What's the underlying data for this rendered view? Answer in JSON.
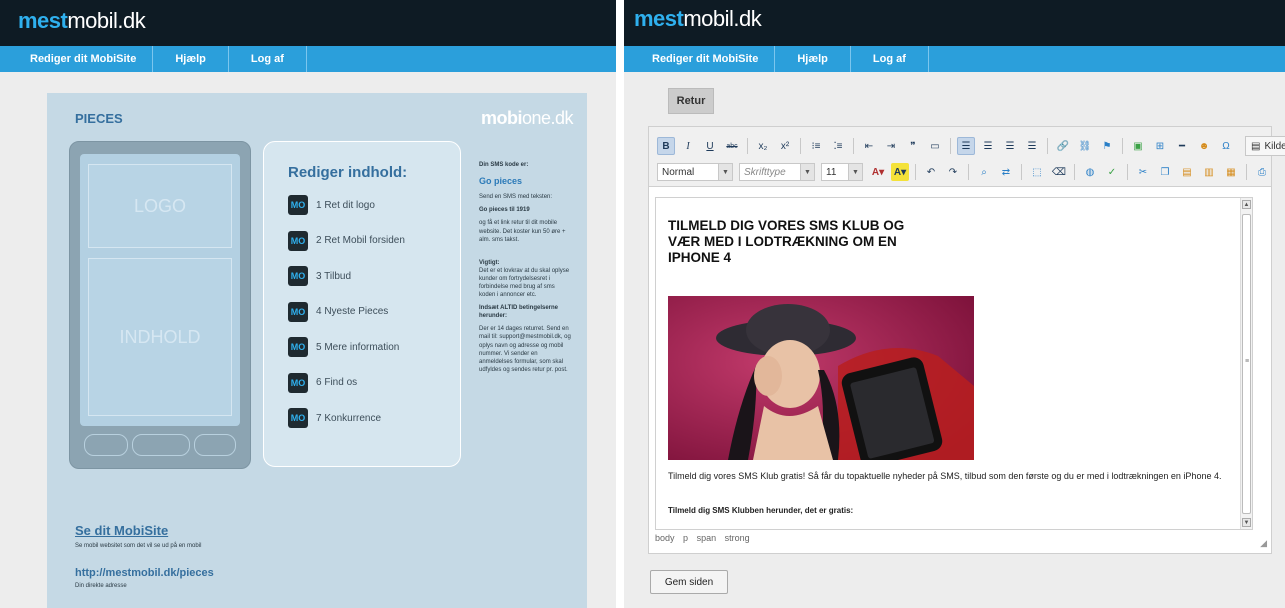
{
  "brand": {
    "logo_accent": "mest",
    "logo_rest": "mobil.dk"
  },
  "nav": [
    {
      "label": "Rediger dit MobiSite"
    },
    {
      "label": "Hjælp"
    },
    {
      "label": "Log af"
    }
  ],
  "left": {
    "pieces": "PIECES",
    "mobione_logo_bold": "mobi",
    "mobione_logo_rest": "one.dk",
    "phone_logo": "LOGO",
    "phone_content": "INDHOLD",
    "edit_title": "Rediger indhold:",
    "edit_items": [
      {
        "label": "1 Ret dit logo"
      },
      {
        "label": "2 Ret Mobil forsiden"
      },
      {
        "label": "3 Tilbud"
      },
      {
        "label": "4 Nyeste Pieces"
      },
      {
        "label": "5 Mere information"
      },
      {
        "label": "6 Find os"
      },
      {
        "label": "7 Konkurrence"
      }
    ],
    "sms_intro": "Din SMS kode er:",
    "sms_code": "Go pieces",
    "sms_send_text": "Send en SMS med teksten:",
    "sms_send_code": "Go pieces til 1919",
    "sms_body": "og få et link retur til dit mobile website. Det koster kun 50 øre + alm. sms takst.",
    "important_title": "Vigtigt:",
    "important_body": "Det er et lovkrav at du skal oplyse kunder om fortrydelsesret i forbindelse med brug af sms koden i annoncer etc.",
    "insert_title": "Indsæt ALTID betingelserne herunder:",
    "insert_body": "Der er 14 dages returret. Send en mail til: support@mestmobil.dk, og oplys navn og adresse og mobil nummer. Vi sender en anmeldelses formular, som skal udfyldes og sendes retur pr. post.",
    "see_link": "Se dit MobiSite",
    "see_sub": "Se mobil websitet som det vil se ud på en mobil",
    "url": "http://mestmobil.dk/pieces",
    "url_sub": "Din direkte adresse"
  },
  "right": {
    "retur_label": "Retur",
    "toolbar": {
      "source_label": "Kilde",
      "format_value": "Normal",
      "font_placeholder": "Skrifttype",
      "size_value": "11"
    },
    "doc": {
      "headline": "TILMELD DIG VORES SMS KLUB OG VÆR MED I LODTRÆKNING OM EN IPHONE 4",
      "paragraph": "Tilmeld dig vores SMS Klub gratis! Så får du topaktuelle nyheder på SMS, tilbud som den første og du er med i lodtrækningen en iPhone 4.",
      "paragraph_bold": "Tilmeld dig SMS Klubben herunder, det er gratis:"
    },
    "path": [
      "body",
      "p",
      "span",
      "strong"
    ],
    "save_label": "Gem siden"
  },
  "colors": {
    "header_bg": "#0e1b24",
    "nav_bg": "#2b9fdb",
    "accent": "#2fb0ee",
    "mock_bg": "#c5d9e5",
    "link": "#356f9e"
  },
  "icons": [
    "bold-icon",
    "italic-icon",
    "underline-icon",
    "strike-icon",
    "subscript-icon",
    "superscript-icon",
    "ordered-list-icon",
    "bullet-list-icon",
    "outdent-icon",
    "indent-icon",
    "blockquote-icon",
    "div-icon",
    "align-left-icon",
    "align-center-icon",
    "align-right-icon",
    "justify-icon",
    "link-icon",
    "unlink-icon",
    "anchor-icon",
    "image-icon",
    "table-icon",
    "hr-icon",
    "smiley-icon",
    "special-char-icon",
    "source-icon",
    "text-color-icon",
    "bg-color-icon",
    "undo-icon",
    "redo-icon",
    "find-icon",
    "replace-icon",
    "select-all-icon",
    "remove-format-icon",
    "globe-icon",
    "spellcheck-icon",
    "cut-icon",
    "copy-icon",
    "paste-icon",
    "paste-text-icon",
    "paste-word-icon",
    "print-icon",
    "mo-icon",
    "resize-icon"
  ]
}
